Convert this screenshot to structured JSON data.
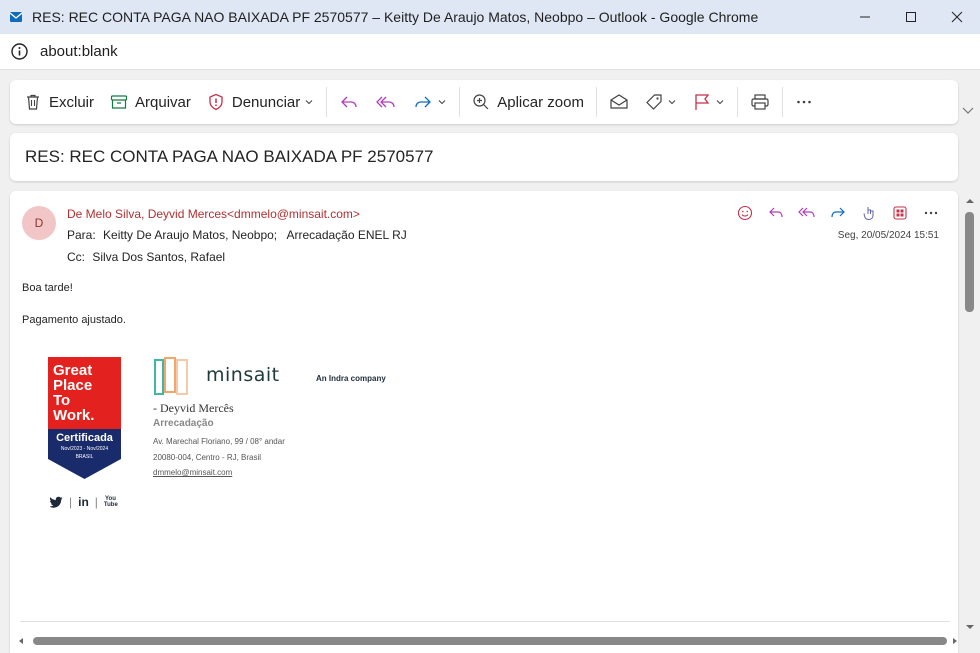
{
  "window": {
    "title": "RES: REC CONTA PAGA NAO BAIXADA PF 2570577 – Keitty De Araujo Matos, Neobpo – Outlook - Google Chrome",
    "url": "about:blank"
  },
  "toolbar": {
    "delete_label": "Excluir",
    "archive_label": "Arquivar",
    "report_label": "Denunciar",
    "zoom_label": "Aplicar zoom"
  },
  "message": {
    "subject": "RES: REC CONTA PAGA NAO BAIXADA PF 2570577",
    "avatar_initial": "D",
    "from": "De Melo Silva, Deyvid Merces<dmmelo@minsait.com>",
    "to_label": "Para:",
    "to_value": "Keitty De Araujo Matos, Neobpo;",
    "to_value2": "Arrecadação ENEL RJ",
    "cc_label": "Cc:",
    "cc_value": "Silva Dos Santos, Rafael",
    "date": "Seg, 20/05/2024 15:51",
    "body_greeting": "Boa tarde!",
    "body_line": "Pagamento ajustado."
  },
  "signature": {
    "gptw_line1": "Great",
    "gptw_line2": "Place",
    "gptw_line3": "To",
    "gptw_line4": "Work.",
    "gptw_cert": "Certificada",
    "gptw_period": "Nov/2023 - Nov/2024",
    "gptw_country": "BRASIL",
    "brand": "minsait",
    "indra": "An Indra company",
    "name": "- Deyvid Mercês",
    "dept": "Arrecadação",
    "address1": "Av. Marechal Floriano, 99 / 08° andar",
    "address2": "20080-004, Centro - RJ, Brasil",
    "email": "dmmelo@minsait.com",
    "social_twitter": "twitter-icon",
    "social_linkedin": "in",
    "social_youtube": "You Tube"
  },
  "colors": {
    "sender": "#b33030",
    "report_icon": "#c4314b",
    "reply_icons": "#b23cbb",
    "forward_icon": "#0f6cbd",
    "flag_icon": "#c4314b"
  }
}
